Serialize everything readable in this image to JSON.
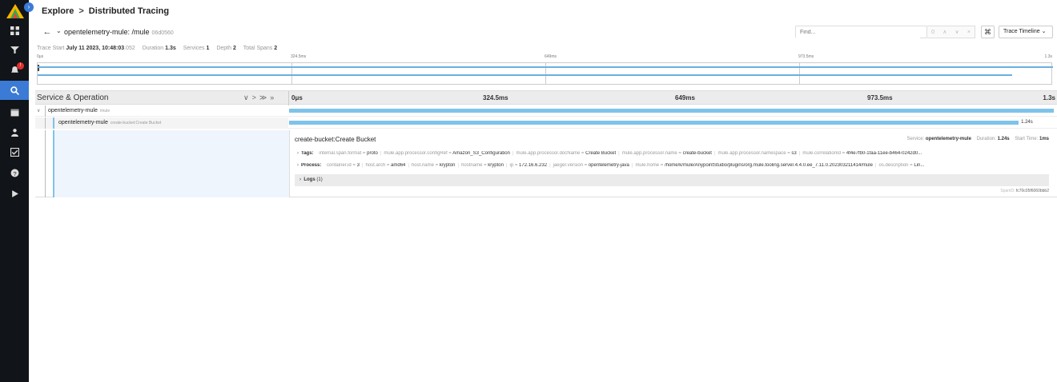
{
  "breadcrumb": {
    "root": "Explore",
    "separator": ">",
    "current": "Distributed Tracing"
  },
  "trace": {
    "service_path": "opentelemetry-mule: /mule",
    "trace_id_short": "06d0560",
    "find_placeholder": "Find...",
    "view_select": "Trace Timeline",
    "find_count": "0"
  },
  "meta": {
    "start_label": "Trace Start",
    "start_date": "July 11 2023, 10:48:03",
    "start_ms": ".052",
    "duration_label": "Duration",
    "duration": "1.3s",
    "services_label": "Services",
    "services": "1",
    "depth_label": "Depth",
    "depth": "2",
    "spans_label": "Total Spans",
    "spans": "2"
  },
  "minimap": {
    "ticks": [
      "0μs",
      "324.5ms",
      "649ms",
      "973.5ms",
      "1.3s"
    ]
  },
  "header": {
    "title": "Service & Operation",
    "ticks": [
      "0μs",
      "324.5ms",
      "649ms",
      "973.5ms",
      "1.3s"
    ]
  },
  "spans": [
    {
      "service": "opentelemetry-mule",
      "operation": "/mule",
      "start_fraction": 0.0,
      "duration_fraction": 1.0,
      "duration_label": ""
    },
    {
      "service": "opentelemetry-mule",
      "operation": "create-bucket:Create Bucket",
      "start_fraction": 0.0,
      "duration_fraction": 0.954,
      "duration_label": "1.24s"
    }
  ],
  "detail": {
    "title": "create-bucket:Create Bucket",
    "service_label": "Service:",
    "service": "opentelemetry-mule",
    "duration_label": "Duration:",
    "duration": "1.24s",
    "start_label": "Start Time:",
    "start": "1ms",
    "tags_label": "Tags:",
    "tags": [
      {
        "k": "internal.span.format",
        "v": "proto"
      },
      {
        "k": "mule.app.processor.configRef",
        "v": "Amazon_S3_Configuration"
      },
      {
        "k": "mule.app.processor.docName",
        "v": "Create Bucket"
      },
      {
        "k": "mule.app.processor.name",
        "v": "create-bucket"
      },
      {
        "k": "mule.app.processor.namespace",
        "v": "s3"
      },
      {
        "k": "mule.correlationId",
        "v": "4f4e7fb0-1faa-11ee-b464-0242d0..."
      }
    ],
    "process_label": "Process:",
    "process": [
      {
        "k": "container.id",
        "v": "3"
      },
      {
        "k": "host.arch",
        "v": "amd64"
      },
      {
        "k": "host.name",
        "v": "krypton"
      },
      {
        "k": "hostname",
        "v": "krypton"
      },
      {
        "k": "ip",
        "v": "172.16.6.232"
      },
      {
        "k": "jaeger.version",
        "v": "opentelemetry-java"
      },
      {
        "k": "mule.home",
        "v": "/home/k/mule/AnypointStudio/plugins/org.mule.tooling.server.4.4.0.ee_7.11.0.202303211414/mule"
      },
      {
        "k": "os.description",
        "v": "Lin..."
      }
    ],
    "logs_label": "Logs",
    "logs_count": "(1)",
    "spanid_label": "SpanID:",
    "spanid": "fc70c05f6060bbb2"
  },
  "colors": {
    "accent": "#3b7bd6",
    "span_bar": "#7ec3ea",
    "alert": "#e02f2f"
  },
  "icons": [
    "grafana-logo",
    "dashboards-icon",
    "filter-icon",
    "alerting-icon",
    "explore-icon",
    "calendar-icon",
    "user-icon",
    "checklist-icon",
    "help-icon",
    "play-icon"
  ]
}
